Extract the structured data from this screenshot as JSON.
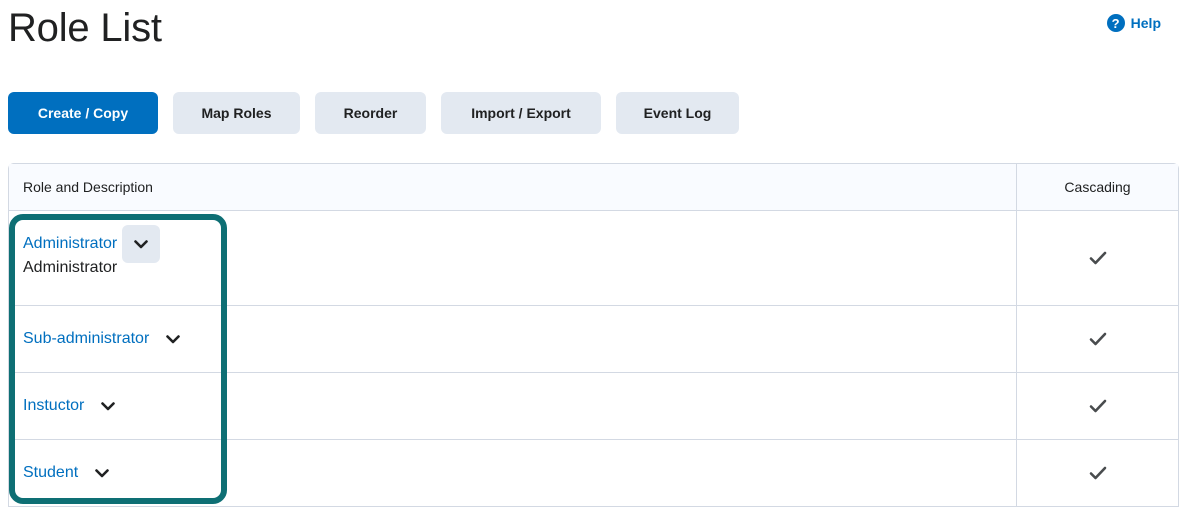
{
  "header": {
    "title": "Role List",
    "help_label": "Help"
  },
  "toolbar": {
    "buttons": [
      {
        "label": "Create / Copy"
      },
      {
        "label": "Map Roles"
      },
      {
        "label": "Reorder"
      },
      {
        "label": "Import / Export"
      },
      {
        "label": "Event Log"
      }
    ]
  },
  "table": {
    "columns": [
      "Role and Description",
      "Cascading"
    ],
    "rows": [
      {
        "role": "Administrator",
        "description": "Administrator",
        "cascading": true
      },
      {
        "role": "Sub-administrator",
        "description": "",
        "cascading": true
      },
      {
        "role": "Instuctor",
        "description": "",
        "cascading": true
      },
      {
        "role": "Student",
        "description": "",
        "cascading": true
      }
    ]
  },
  "colors": {
    "accent": "#006fbf",
    "highlight": "#0e6f74",
    "button_bg": "#e3e9f1"
  }
}
